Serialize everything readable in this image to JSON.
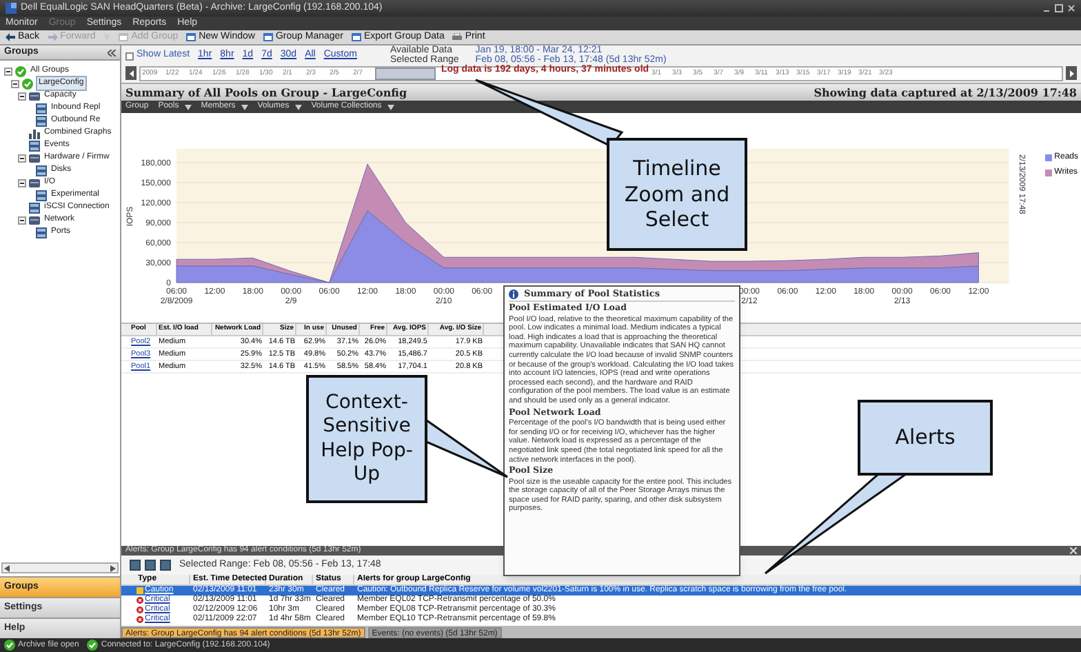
{
  "window": {
    "title": "Dell EqualLogic SAN HeadQuarters (Beta) - Archive: LargeConfig (192.168.200.104)"
  },
  "menu": [
    {
      "label": "Monitor",
      "disabled": false
    },
    {
      "label": "Group",
      "disabled": true
    },
    {
      "label": "Settings",
      "disabled": false
    },
    {
      "label": "Reports",
      "disabled": false
    },
    {
      "label": "Help",
      "disabled": false
    }
  ],
  "toolbar": [
    {
      "label": "Back",
      "disabled": false,
      "kind": "back"
    },
    {
      "label": "Forward",
      "disabled": true,
      "kind": "forward"
    },
    {
      "label": "Add Group",
      "disabled": true,
      "kind": "add"
    },
    {
      "label": "New Window",
      "disabled": false,
      "kind": "window"
    },
    {
      "label": "Group Manager",
      "disabled": false,
      "kind": "manager"
    },
    {
      "label": "Export Group Data",
      "disabled": false,
      "kind": "export"
    },
    {
      "label": "Print",
      "disabled": false,
      "kind": "print"
    }
  ],
  "sidebar": {
    "title": "Groups",
    "tree": [
      {
        "label": "All Groups",
        "kind": "group",
        "expanded": true,
        "selected": false,
        "children": [
          {
            "label": "LargeConfig",
            "kind": "group",
            "expanded": true,
            "selected": true,
            "children": [
              {
                "label": "Capacity",
                "kind": "folder",
                "expanded": true,
                "selected": false,
                "children": [
                  {
                    "label": "Inbound Repl",
                    "kind": "item",
                    "selected": false
                  },
                  {
                    "label": "Outbound Re",
                    "kind": "item",
                    "selected": false
                  }
                ]
              },
              {
                "label": "Combined Graphs",
                "kind": "chart",
                "selected": false
              },
              {
                "label": "Events",
                "kind": "item",
                "selected": false
              },
              {
                "label": "Hardware / Firmw",
                "kind": "folder",
                "expanded": true,
                "selected": false,
                "children": [
                  {
                    "label": "Disks",
                    "kind": "item",
                    "selected": false
                  }
                ]
              },
              {
                "label": "I/O",
                "kind": "folder",
                "expanded": true,
                "selected": false,
                "children": [
                  {
                    "label": "Experimental",
                    "kind": "item",
                    "selected": false
                  }
                ]
              },
              {
                "label": "iSCSI Connection",
                "kind": "item",
                "selected": false
              },
              {
                "label": "Network",
                "kind": "folder",
                "expanded": true,
                "selected": false,
                "children": [
                  {
                    "label": "Ports",
                    "kind": "item",
                    "selected": false
                  }
                ]
              }
            ]
          }
        ]
      }
    ],
    "nav": [
      {
        "label": "Groups",
        "selected": true
      },
      {
        "label": "Settings",
        "selected": false
      },
      {
        "label": "Help",
        "selected": false
      }
    ]
  },
  "timeline": {
    "show_latest": {
      "label": "Show Latest",
      "checked": false
    },
    "ranges": [
      "1hr",
      "8hr",
      "1d",
      "7d",
      "30d",
      "All",
      "Custom"
    ],
    "available_label": "Available Data",
    "available": "Jan 19, 18:00 - Mar 24, 12:21",
    "selected_label": "Selected Range",
    "selected": "Feb 08, 05:56 - Feb 13, 17:48 (5d 13hr 52m)",
    "ticks_before": [
      "2009",
      "1/22",
      "1/24",
      "1/26",
      "1/28",
      "1/30",
      "2/1",
      "2/3",
      "2/5",
      "2/7"
    ],
    "message": "Log data is 192 days, 4 hours, 37 minutes old",
    "ticks_after": [
      "3/1",
      "3/3",
      "3/5",
      "3/7",
      "3/9",
      "3/11",
      "3/13",
      "3/15",
      "3/17",
      "3/19",
      "3/21",
      "3/23"
    ]
  },
  "summary": {
    "title": "Summary of All Pools on Group - LargeConfig",
    "captured": "Showing data captured at 2/13/2009 17:48",
    "nav": [
      "Group",
      "Pools",
      "Members",
      "Volumes",
      "Volume Collections"
    ],
    "chart_data": {
      "type": "area",
      "stacked": true,
      "ylabel": "IOPS",
      "categories": [
        "06:00\n2/8/2009",
        "12:00",
        "18:00",
        "00:00\n2/9",
        "06:00",
        "12:00",
        "18:00",
        "00:00\n2/10",
        "06:00",
        null,
        null,
        null,
        null,
        null,
        null,
        "00:00\n2/12",
        "06:00",
        "12:00",
        "18:00",
        "00:00\n2/13",
        "06:00",
        "12:00"
      ],
      "ylim": [
        0,
        180000
      ],
      "grid": true,
      "legend": true,
      "yticks": [
        {
          "value": 0,
          "label": "0"
        },
        {
          "value": 30000,
          "label": "30,000"
        },
        {
          "value": 60000,
          "label": "60,000"
        },
        {
          "value": 90000,
          "label": "90,000"
        },
        {
          "value": 120000,
          "label": "120,000"
        },
        {
          "value": 150000,
          "label": "150,000"
        },
        {
          "value": 180000,
          "label": "180,000"
        }
      ],
      "series": [
        {
          "name": "Reads",
          "color": "#8c8ce6",
          "values": [
            25000,
            25000,
            25000,
            12000,
            0,
            108000,
            60000,
            22000,
            22000,
            22000,
            22000,
            22000,
            22000,
            20000,
            18000,
            18000,
            18000,
            20000,
            22000,
            22000,
            22000,
            25000
          ]
        },
        {
          "name": "Writes",
          "color": "#c48cb4",
          "values": [
            10000,
            10000,
            12000,
            5000,
            0,
            70000,
            30000,
            16000,
            16000,
            16000,
            16000,
            16000,
            16000,
            15000,
            14000,
            14000,
            15000,
            15000,
            16000,
            16000,
            18000,
            20000
          ]
        }
      ]
    },
    "chart_stamp": "2/13/2009 17:48",
    "table": {
      "columns": [
        "Pool",
        "Est. I/O load",
        "Network Load",
        "Size",
        "In use",
        "Unused",
        "Free",
        "Avg. IOPS",
        "Avg. I/O Size"
      ],
      "rows": [
        {
          "cells": [
            "Pool2",
            "Medium",
            "30.4%",
            "14.6 TB",
            "62.9%",
            "37.1%",
            "26.0%",
            "18,249.5",
            "17.9 KB"
          ]
        },
        {
          "cells": [
            "Pool3",
            "Medium",
            "25.9%",
            "12.5 TB",
            "49.8%",
            "50.2%",
            "43.7%",
            "15,486.7",
            "20.5 KB"
          ]
        },
        {
          "cells": [
            "Pool1",
            "Medium",
            "32.5%",
            "14.6 TB",
            "41.5%",
            "58.5%",
            "58.4%",
            "17,704.1",
            "20.8 KB"
          ]
        }
      ]
    }
  },
  "help_popup": {
    "title": "Summary of Pool Statistics",
    "sections": [
      {
        "heading": "Pool Estimated I/O Load",
        "text": "Pool I/O load, relative to the theoretical maximum capability of the pool.  Low indicates a minimal load.  Medium indicates a typical load.  High indicates a load that is approaching the theoretical maximum capability.  Unavailable indicates that SAN HQ cannot currently calculate the I/O load because of invalid SNMP counters or because of the group's workload.  Calculating the I/O load takes into account I/O latencies, IOPS (read and write operations processed each second), and the hardware and RAID configuration of the pool members.  The load value is an estimate and should be used only as a general indicator."
      },
      {
        "heading": "Pool Network Load",
        "text": "Percentage of the pool's I/O bandwidth that is being used either for sending I/O or for receiving I/O, whichever has the higher value.  Network load is expressed as a percentage of the negotiated link speed (the total negotiated link speed for all the active network interfaces in the pool)."
      },
      {
        "heading": "Pool Size",
        "text": "Pool size is the useable capacity for the entire pool.  This includes the storage capacity of all of the Peer Storage Arrays minus the space used for RAID parity, sparing, and other disk subsystem purposes."
      }
    ]
  },
  "alerts": {
    "header": "Alerts: Group LargeConfig has 94 alert conditions (5d 13hr 52m)",
    "range": "Selected Range: Feb 08, 05:56 - Feb 13, 17:48",
    "columns": [
      "Type",
      "Est. Time Detected",
      "Duration",
      "Status",
      "Alerts for group LargeConfig"
    ],
    "rows": [
      {
        "type": "Caution",
        "kind": "caution",
        "selected": true,
        "time": "02/13/2009 11:01",
        "duration": "23hr 30m",
        "status": "Cleared",
        "text": "Caution: Outbound Replica Reserve for volume vol2201-Saturn is 100% in use.  Replica scratch space is borrowing from the free pool."
      },
      {
        "type": "Critical",
        "kind": "critical",
        "selected": false,
        "time": "02/13/2009 11:01",
        "duration": "1d 7hr 33m",
        "status": "Cleared",
        "text": "Member EQL02 TCP-Retransmit percentage of 50.0%"
      },
      {
        "type": "Critical",
        "kind": "critical",
        "selected": false,
        "time": "02/12/2009 12:06",
        "duration": "10hr 3m",
        "status": "Cleared",
        "text": "Member EQL08 TCP-Retransmit percentage of 30.3%"
      },
      {
        "type": "Critical",
        "kind": "critical",
        "selected": false,
        "time": "02/11/2009 22:07",
        "duration": "1d 4hr 58m",
        "status": "Cleared",
        "text": "Member EQL10 TCP-Retransmit percentage of 59.8%"
      }
    ]
  },
  "bottom_tabs": [
    {
      "label": "Alerts: Group LargeConfig has 94 alert conditions (5d 13hr 52m)",
      "selected": true
    },
    {
      "label": "Events: (no events) (5d 13hr 52m)",
      "selected": false
    }
  ],
  "status_bar": [
    "Archive file open",
    "Connected to: LargeConfig (192.168.200.104)"
  ],
  "callouts": [
    {
      "text": "Timeline Zoom and Select"
    },
    {
      "text": "Context-Sensitive Help Pop-Up"
    },
    {
      "text": "Alerts"
    }
  ]
}
